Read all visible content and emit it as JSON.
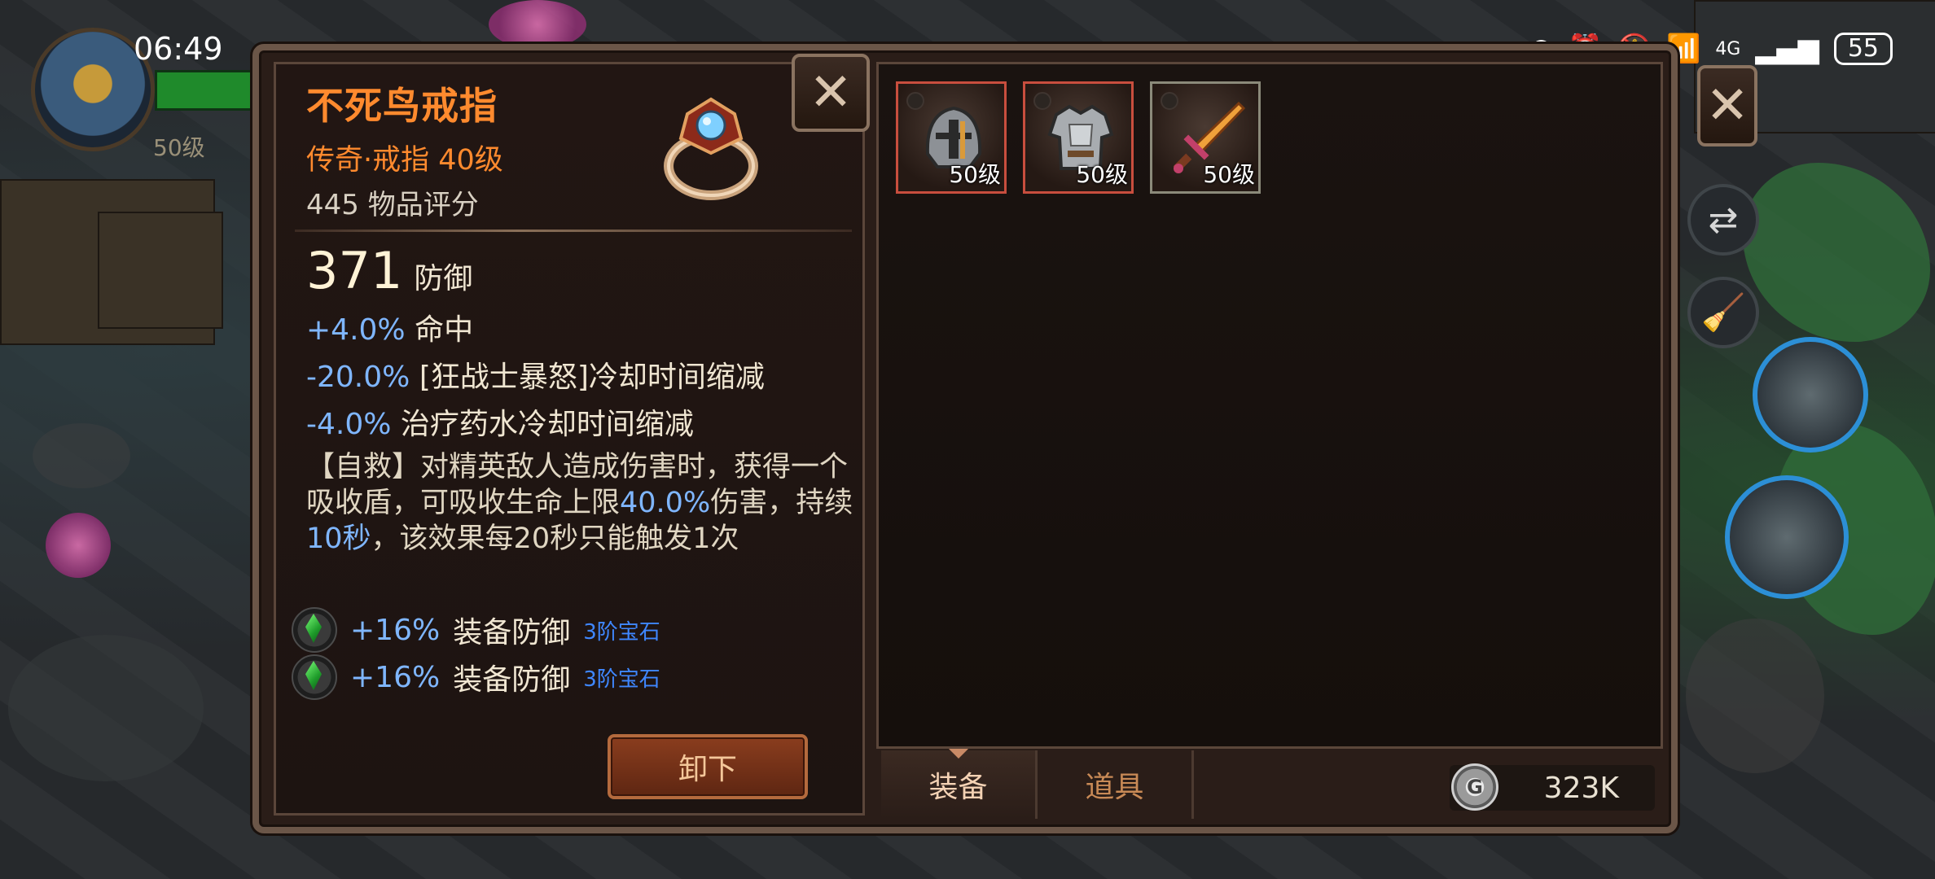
{
  "status_bar": {
    "time": "06:49",
    "battery": "55",
    "network": "4G"
  },
  "hud": {
    "player_level": "50级"
  },
  "item": {
    "name": "不死鸟戒指",
    "subtitle": "传奇·戒指 40级",
    "score": "445 物品评分",
    "main_stat": {
      "value": "371",
      "label": "防御"
    },
    "stats": [
      {
        "value": "+4.0%",
        "text": "命中"
      },
      {
        "value": "-20.0%",
        "text": "[狂战士暴怒]冷却时间缩减"
      },
      {
        "value": "-4.0%",
        "text": "治疗药水冷却时间缩减"
      }
    ],
    "description": {
      "p1": "【自救】对精英敌人造成伤害时，获得一个吸收盾，可吸收生命上限",
      "h1": "40.0%",
      "p2": "伤害，持续",
      "h2": "10秒",
      "p3": "，该效果每20秒只能触发1次"
    },
    "gems": [
      {
        "value": "+16%",
        "text": "装备防御",
        "tier": "3阶宝石"
      },
      {
        "value": "+16%",
        "text": "装备防御",
        "tier": "3阶宝石"
      }
    ],
    "unequip_label": "卸下"
  },
  "inventory": {
    "slots": [
      {
        "icon": "helmet-icon",
        "level": "50级",
        "rarity_color": "#c84e3e"
      },
      {
        "icon": "armor-icon",
        "level": "50级",
        "rarity_color": "#c84e3e"
      },
      {
        "icon": "sword-icon",
        "level": "50级",
        "rarity_color": "#8b8a7a"
      }
    ],
    "tabs": [
      {
        "label": "装备"
      },
      {
        "label": "道具"
      }
    ],
    "currency": "323K"
  }
}
